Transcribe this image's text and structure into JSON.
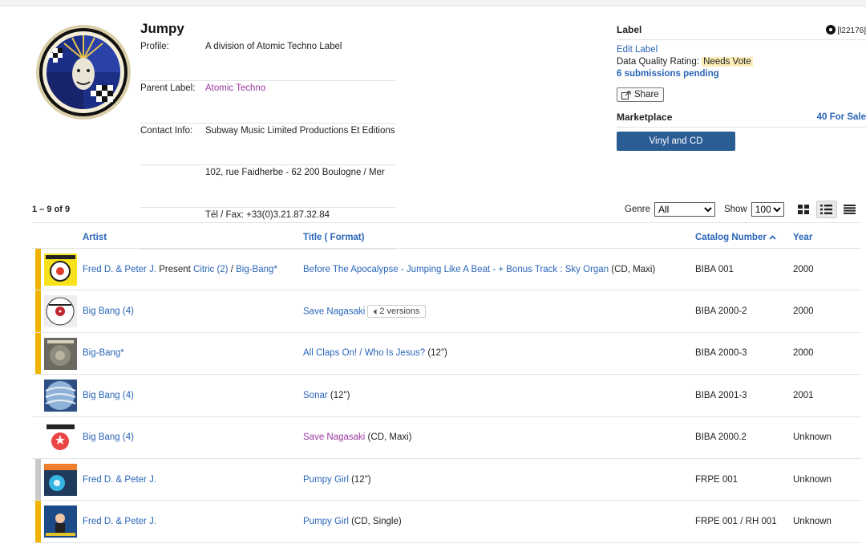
{
  "header": {
    "title": "Jumpy",
    "profile_label": "Profile:",
    "profile": "A division of Atomic Techno Label",
    "parent_label_label": "Parent Label:",
    "parent_label": "Atomic Techno",
    "contact_label": "Contact Info:",
    "contact_lines": [
      "Subway Music Limited Productions Et Editions",
      "102, rue Faidherbe - 62 200 Boulogne / Mer",
      "Tél / Fax: +33(0)3.21.87.32.84"
    ]
  },
  "panel": {
    "label_heading": "Label",
    "label_id": "[l22176]",
    "edit_label": "Edit Label",
    "data_quality_label": "Data Quality Rating:",
    "data_quality_value": "Needs Vote",
    "submissions": "6 submissions pending",
    "share": "Share",
    "marketplace_heading": "Marketplace",
    "for_sale": "40 For Sale",
    "vinyl_button": "Vinyl and CD"
  },
  "toolbar": {
    "count": "1 – 9 of 9",
    "genre_label": "Genre",
    "genre_value": "All",
    "show_label": "Show",
    "show_value": "100"
  },
  "table": {
    "headers": {
      "artist": "Artist",
      "title": "Title",
      "format": "( Format)",
      "catalog": "Catalog Number",
      "year": "Year"
    },
    "rows": [
      {
        "bar": "#f0b400",
        "artist": [
          {
            "t": "Fred D. & Peter J.",
            "link": true
          },
          {
            "t": " Present ",
            "link": false
          },
          {
            "t": "Citric (2)",
            "link": true
          },
          {
            "t": " / ",
            "link": false
          },
          {
            "t": "Big-Bang*",
            "link": true
          }
        ],
        "title": "Before The Apocalypse - Jumping Like A Beat - + Bonus Track : Sky Organ",
        "format": " (CD, Maxi)",
        "versions": "",
        "catalog": "BIBA 001",
        "year": "2000",
        "title_visited": false
      },
      {
        "bar": "#f0b400",
        "artist": [
          {
            "t": "Big Bang (4)",
            "link": true
          }
        ],
        "title": "Save Nagasaki",
        "format": "",
        "versions": "2 versions",
        "catalog": "BIBA 2000-2",
        "year": "2000",
        "title_visited": false
      },
      {
        "bar": "#f0b400",
        "artist": [
          {
            "t": "Big-Bang*",
            "link": true
          }
        ],
        "title": "All Claps On! / Who Is Jesus?",
        "format": " (12\")",
        "versions": "",
        "catalog": "BIBA 2000-3",
        "year": "2000",
        "title_visited": false
      },
      {
        "bar": "",
        "artist": [
          {
            "t": "Big Bang (4)",
            "link": true
          }
        ],
        "title": "Sonar",
        "format": " (12\")",
        "versions": "",
        "catalog": "BIBA 2001-3",
        "year": "2001",
        "title_visited": false
      },
      {
        "bar": "",
        "artist": [
          {
            "t": "Big Bang (4)",
            "link": true
          }
        ],
        "title": "Save Nagasaki",
        "format": " (CD, Maxi)",
        "versions": "",
        "catalog": "BIBA 2000.2",
        "year": "Unknown",
        "title_visited": true
      },
      {
        "bar": "#c8c8c8",
        "artist": [
          {
            "t": "Fred D. & Peter J.",
            "link": true
          }
        ],
        "title": "Pumpy Girl",
        "format": " (12\")",
        "versions": "",
        "catalog": "FRPE 001",
        "year": "Unknown",
        "title_visited": false
      },
      {
        "bar": "#f0b400",
        "artist": [
          {
            "t": "Fred D. & Peter J.",
            "link": true
          }
        ],
        "title": "Pumpy Girl",
        "format": " (CD, Single)",
        "versions": "",
        "catalog": "FRPE 001 / RH 001",
        "year": "Unknown",
        "title_visited": false
      }
    ]
  },
  "colors": {
    "link": "#2a65b8",
    "visited": "#9b3aa0",
    "accent_bar": "#f0b400",
    "button": "#2b5d95",
    "badge": "#fbecb8"
  }
}
